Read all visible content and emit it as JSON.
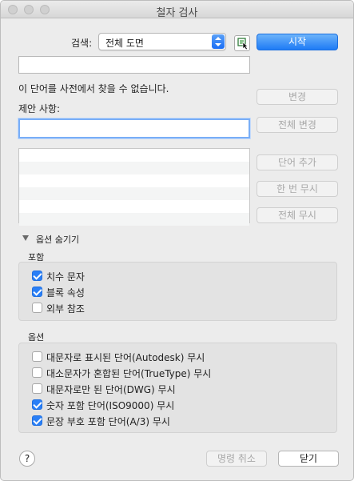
{
  "window": {
    "title": "철자 검사"
  },
  "search": {
    "label": "검색:",
    "selected": "전체 도면"
  },
  "buttons": {
    "start": "시작",
    "change": "변경",
    "change_all": "전체 변경",
    "add_word": "단어 추가",
    "ignore_once": "한 번 무시",
    "ignore_all": "전체 무시",
    "cancel_command": "명령 취소",
    "close": "닫기",
    "help": "?"
  },
  "current_word": {
    "value": ""
  },
  "status_message": "이 단어를 사전에서 찾을 수 없습니다.",
  "suggestions": {
    "label": "제안 사항:",
    "value": "",
    "items": []
  },
  "options_toggle": "옵션 숨기기",
  "include_group": {
    "label": "포함",
    "items": [
      {
        "label": "치수 문자",
        "checked": true
      },
      {
        "label": "블록 속성",
        "checked": true
      },
      {
        "label": "외부 참조",
        "checked": false
      }
    ]
  },
  "options_group": {
    "label": "옵션",
    "items": [
      {
        "label": "대문자로 표시된 단어(Autodesk) 무시",
        "checked": false
      },
      {
        "label": "대소문자가 혼합된 단어(TrueType) 무시",
        "checked": false
      },
      {
        "label": "대문자로만 된 단어(DWG) 무시",
        "checked": false
      },
      {
        "label": "숫자 포함 단어(ISO9000) 무시",
        "checked": true
      },
      {
        "label": "문장 부호 포함 단어(A/3) 무시",
        "checked": true
      }
    ]
  },
  "icons": {
    "select_stepper": "up-down-chevron-icon",
    "pick_button": "select-objects-icon",
    "disclosure": "disclosure-triangle-down-icon"
  },
  "colors": {
    "accent": "#1e7bf5",
    "window_bg": "#ececec"
  }
}
